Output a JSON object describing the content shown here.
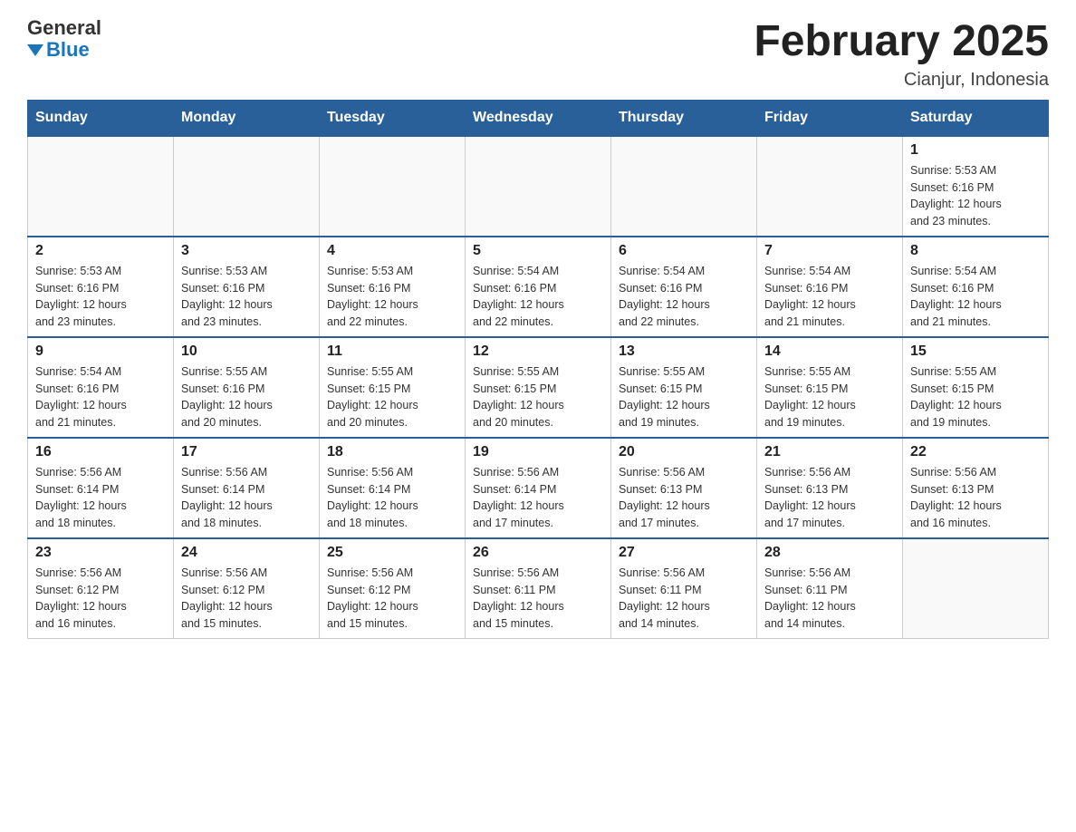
{
  "logo": {
    "general": "General",
    "blue": "Blue",
    "triangle": "▼"
  },
  "header": {
    "title": "February 2025",
    "location": "Cianjur, Indonesia"
  },
  "weekdays": [
    "Sunday",
    "Monday",
    "Tuesday",
    "Wednesday",
    "Thursday",
    "Friday",
    "Saturday"
  ],
  "weeks": [
    [
      {
        "day": "",
        "info": ""
      },
      {
        "day": "",
        "info": ""
      },
      {
        "day": "",
        "info": ""
      },
      {
        "day": "",
        "info": ""
      },
      {
        "day": "",
        "info": ""
      },
      {
        "day": "",
        "info": ""
      },
      {
        "day": "1",
        "info": "Sunrise: 5:53 AM\nSunset: 6:16 PM\nDaylight: 12 hours\nand 23 minutes."
      }
    ],
    [
      {
        "day": "2",
        "info": "Sunrise: 5:53 AM\nSunset: 6:16 PM\nDaylight: 12 hours\nand 23 minutes."
      },
      {
        "day": "3",
        "info": "Sunrise: 5:53 AM\nSunset: 6:16 PM\nDaylight: 12 hours\nand 23 minutes."
      },
      {
        "day": "4",
        "info": "Sunrise: 5:53 AM\nSunset: 6:16 PM\nDaylight: 12 hours\nand 22 minutes."
      },
      {
        "day": "5",
        "info": "Sunrise: 5:54 AM\nSunset: 6:16 PM\nDaylight: 12 hours\nand 22 minutes."
      },
      {
        "day": "6",
        "info": "Sunrise: 5:54 AM\nSunset: 6:16 PM\nDaylight: 12 hours\nand 22 minutes."
      },
      {
        "day": "7",
        "info": "Sunrise: 5:54 AM\nSunset: 6:16 PM\nDaylight: 12 hours\nand 21 minutes."
      },
      {
        "day": "8",
        "info": "Sunrise: 5:54 AM\nSunset: 6:16 PM\nDaylight: 12 hours\nand 21 minutes."
      }
    ],
    [
      {
        "day": "9",
        "info": "Sunrise: 5:54 AM\nSunset: 6:16 PM\nDaylight: 12 hours\nand 21 minutes."
      },
      {
        "day": "10",
        "info": "Sunrise: 5:55 AM\nSunset: 6:16 PM\nDaylight: 12 hours\nand 20 minutes."
      },
      {
        "day": "11",
        "info": "Sunrise: 5:55 AM\nSunset: 6:15 PM\nDaylight: 12 hours\nand 20 minutes."
      },
      {
        "day": "12",
        "info": "Sunrise: 5:55 AM\nSunset: 6:15 PM\nDaylight: 12 hours\nand 20 minutes."
      },
      {
        "day": "13",
        "info": "Sunrise: 5:55 AM\nSunset: 6:15 PM\nDaylight: 12 hours\nand 19 minutes."
      },
      {
        "day": "14",
        "info": "Sunrise: 5:55 AM\nSunset: 6:15 PM\nDaylight: 12 hours\nand 19 minutes."
      },
      {
        "day": "15",
        "info": "Sunrise: 5:55 AM\nSunset: 6:15 PM\nDaylight: 12 hours\nand 19 minutes."
      }
    ],
    [
      {
        "day": "16",
        "info": "Sunrise: 5:56 AM\nSunset: 6:14 PM\nDaylight: 12 hours\nand 18 minutes."
      },
      {
        "day": "17",
        "info": "Sunrise: 5:56 AM\nSunset: 6:14 PM\nDaylight: 12 hours\nand 18 minutes."
      },
      {
        "day": "18",
        "info": "Sunrise: 5:56 AM\nSunset: 6:14 PM\nDaylight: 12 hours\nand 18 minutes."
      },
      {
        "day": "19",
        "info": "Sunrise: 5:56 AM\nSunset: 6:14 PM\nDaylight: 12 hours\nand 17 minutes."
      },
      {
        "day": "20",
        "info": "Sunrise: 5:56 AM\nSunset: 6:13 PM\nDaylight: 12 hours\nand 17 minutes."
      },
      {
        "day": "21",
        "info": "Sunrise: 5:56 AM\nSunset: 6:13 PM\nDaylight: 12 hours\nand 17 minutes."
      },
      {
        "day": "22",
        "info": "Sunrise: 5:56 AM\nSunset: 6:13 PM\nDaylight: 12 hours\nand 16 minutes."
      }
    ],
    [
      {
        "day": "23",
        "info": "Sunrise: 5:56 AM\nSunset: 6:12 PM\nDaylight: 12 hours\nand 16 minutes."
      },
      {
        "day": "24",
        "info": "Sunrise: 5:56 AM\nSunset: 6:12 PM\nDaylight: 12 hours\nand 15 minutes."
      },
      {
        "day": "25",
        "info": "Sunrise: 5:56 AM\nSunset: 6:12 PM\nDaylight: 12 hours\nand 15 minutes."
      },
      {
        "day": "26",
        "info": "Sunrise: 5:56 AM\nSunset: 6:11 PM\nDaylight: 12 hours\nand 15 minutes."
      },
      {
        "day": "27",
        "info": "Sunrise: 5:56 AM\nSunset: 6:11 PM\nDaylight: 12 hours\nand 14 minutes."
      },
      {
        "day": "28",
        "info": "Sunrise: 5:56 AM\nSunset: 6:11 PM\nDaylight: 12 hours\nand 14 minutes."
      },
      {
        "day": "",
        "info": ""
      }
    ]
  ]
}
